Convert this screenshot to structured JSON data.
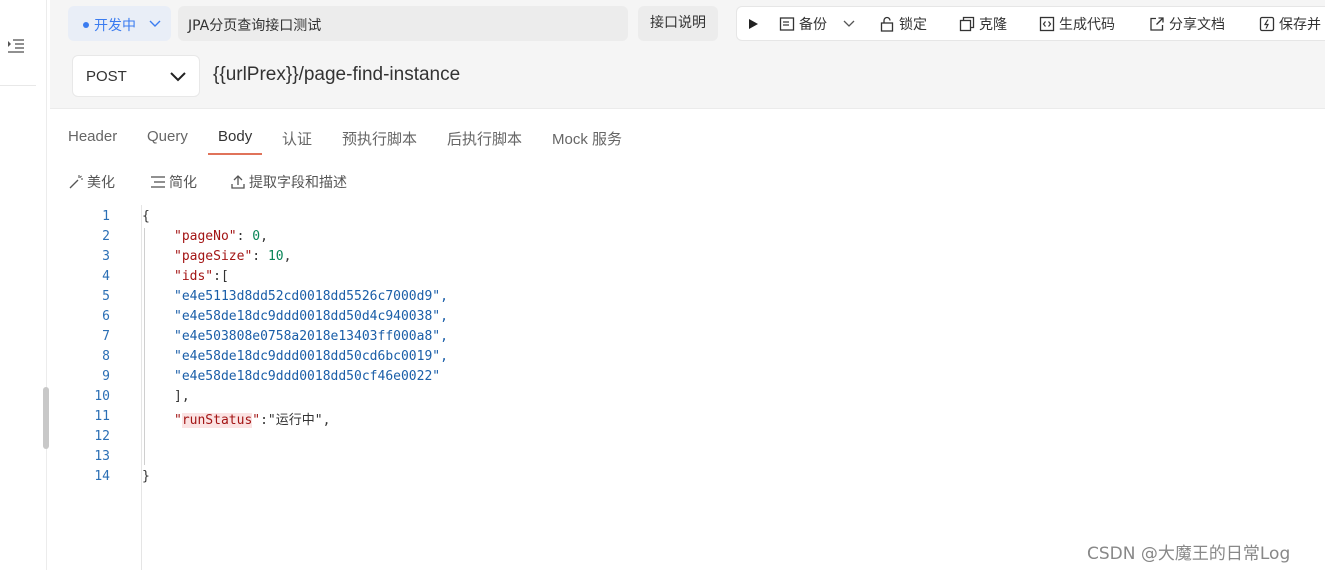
{
  "header": {
    "status_label": "开发中",
    "api_name": "JPA分页查询接口测试",
    "doc_button": "接口说明",
    "toolbar": {
      "backup": "备份",
      "lock": "锁定",
      "clone": "克隆",
      "generate_code": "生成代码",
      "share_doc": "分享文档",
      "save": "保存并"
    }
  },
  "request": {
    "method": "POST",
    "url": "{{urlPrex}}/page-find-instance"
  },
  "tabs": [
    {
      "label": "Header"
    },
    {
      "label": "Query"
    },
    {
      "label": "Body"
    },
    {
      "label": "认证"
    },
    {
      "label": "预执行脚本"
    },
    {
      "label": "后执行脚本"
    },
    {
      "label": "Mock 服务"
    }
  ],
  "body_toolbar": {
    "beautify": "美化",
    "simplify": "简化",
    "extract": "提取字段和描述"
  },
  "editor": {
    "line_numbers": [
      "1",
      "2",
      "3",
      "4",
      "5",
      "6",
      "7",
      "8",
      "9",
      "10",
      "11",
      "12",
      "13",
      "14"
    ],
    "l1": "{",
    "l2_key": "\"pageNo\"",
    "l2_rest": ": ",
    "l2_val": "0",
    "l3_key": "\"pageSize\"",
    "l3_rest": ": ",
    "l3_val": "10",
    "l4_key": "\"ids\"",
    "l4_rest": ":[",
    "ids": [
      "\"e4e5113d8dd52cd0018dd5526c7000d9\",",
      "\"e4e58de18dc9ddd0018dd50d4c940038\",",
      "\"e4e503808e0758a2018e13403ff000a8\",",
      "\"e4e58de18dc9ddd0018dd50cd6bc0019\",",
      "\"e4e58de18dc9ddd0018dd50cf46e0022\""
    ],
    "l10": "],",
    "l11_q1": "\"",
    "l11_key": "runStatus",
    "l11_q2": "\"",
    "l11_rest": ":\"运行中\",",
    "l14": "}"
  },
  "watermark": "CSDN @大魔王的日常Log",
  "colors": {
    "accent_blue": "#3b7cf0",
    "tab_underline": "#e0735a",
    "json_key": "#a31515",
    "json_string": "#1a5ea8",
    "json_number": "#098658"
  }
}
